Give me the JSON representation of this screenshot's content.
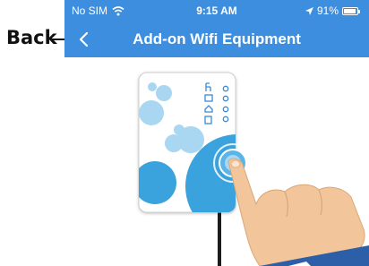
{
  "annotation": {
    "label": "Back"
  },
  "status_bar": {
    "carrier": "No SIM",
    "time": "9:15 AM",
    "battery": "91%"
  },
  "nav": {
    "title": "Add-on Wifi Equipment"
  },
  "illustration": {
    "subject": "hand pressing button on wifi device"
  },
  "colors": {
    "header": "#3e8ee0",
    "device_blue": "#3aa3dd",
    "device_light_blue": "#a9d6f1",
    "device_icons": "#3a8ad8",
    "hand_skin": "#f2c59b"
  }
}
